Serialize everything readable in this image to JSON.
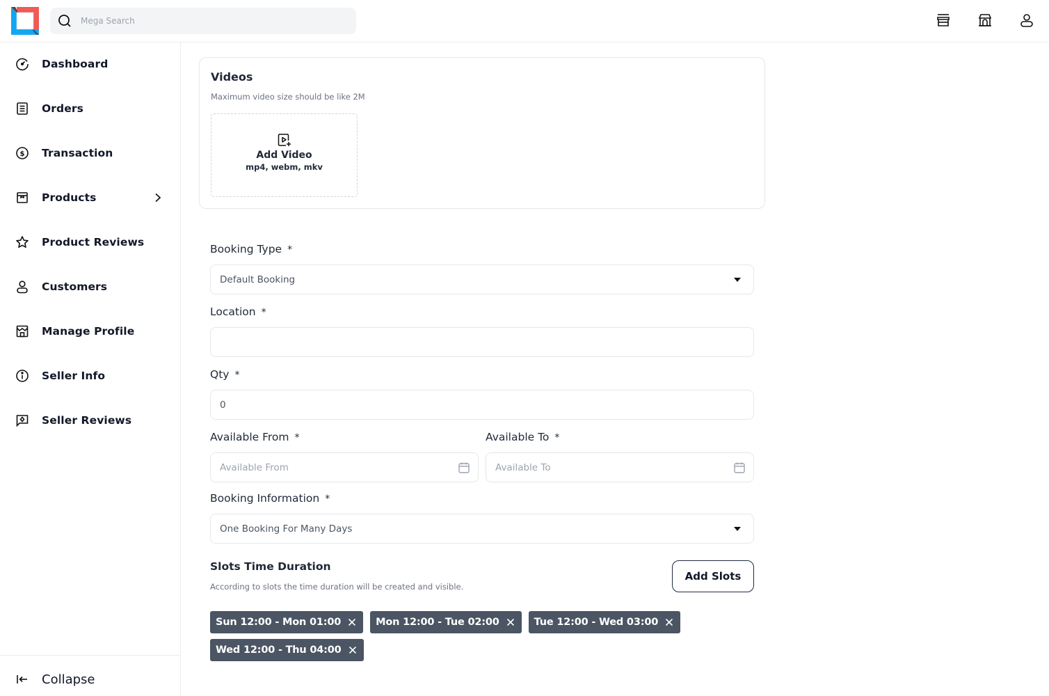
{
  "header": {
    "search_placeholder": "Mega Search",
    "icons": [
      "store-icon",
      "shop-icon",
      "user-icon"
    ]
  },
  "sidebar": {
    "items": [
      {
        "label": "Dashboard",
        "icon": "dashboard-gauge-icon"
      },
      {
        "label": "Orders",
        "icon": "orders-list-icon"
      },
      {
        "label": "Transaction",
        "icon": "dollar-circle-icon"
      },
      {
        "label": "Products",
        "icon": "product-box-icon",
        "has_submenu": true
      },
      {
        "label": "Product Reviews",
        "icon": "star-icon"
      },
      {
        "label": "Customers",
        "icon": "user-icon"
      },
      {
        "label": "Manage Profile",
        "icon": "storefront-icon"
      },
      {
        "label": "Seller Info",
        "icon": "info-icon"
      },
      {
        "label": "Seller Reviews",
        "icon": "review-message-icon"
      }
    ],
    "collapse_label": "Collapse"
  },
  "videos": {
    "title": "Videos",
    "subtitle": "Maximum video size should be like 2M",
    "add_label": "Add Video",
    "formats": "mp4, webm, mkv"
  },
  "form": {
    "booking_type": {
      "label": "Booking Type",
      "required": "*",
      "value": "Default Booking"
    },
    "location": {
      "label": "Location",
      "required": "*",
      "value": "",
      "placeholder": ""
    },
    "qty": {
      "label": "Qty",
      "required": "*",
      "value": "0"
    },
    "available_from": {
      "label": "Available From",
      "required": "*",
      "value": "",
      "placeholder": "Available From"
    },
    "available_to": {
      "label": "Available To",
      "required": "*",
      "value": "",
      "placeholder": "Available To"
    },
    "booking_information": {
      "label": "Booking Information",
      "required": "*",
      "value": "One Booking For Many Days"
    }
  },
  "slots": {
    "title": "Slots Time Duration",
    "subtitle": "According to slots the time duration will be created and visible.",
    "add_button": "Add Slots",
    "items": [
      "Sun 12:00 - Mon 01:00",
      "Mon 12:00 - Tue 02:00",
      "Tue 12:00 - Wed 03:00",
      "Wed 12:00 - Thu 04:00"
    ]
  },
  "colors": {
    "chip_bg": "#4b5563",
    "border": "#e5e7eb",
    "logo_red": "#f25a55",
    "logo_blue": "#12a7f0"
  }
}
